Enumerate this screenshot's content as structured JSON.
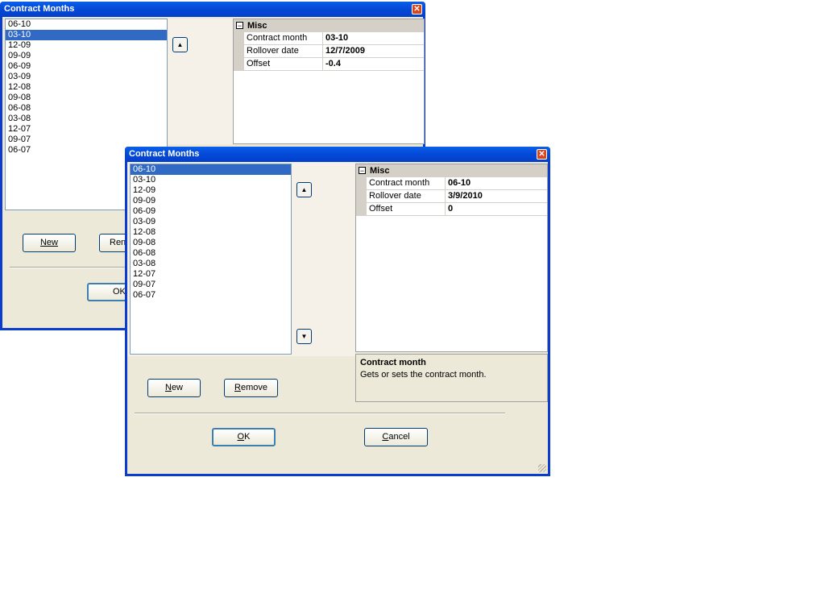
{
  "back_window": {
    "title": "Contract Months",
    "months": [
      "06-10",
      "03-10",
      "12-09",
      "09-09",
      "06-09",
      "03-09",
      "12-08",
      "09-08",
      "06-08",
      "03-08",
      "12-07",
      "09-07",
      "06-07"
    ],
    "selected_index": 1,
    "property_grid": {
      "category": "Misc",
      "rows": [
        {
          "name": "Contract month",
          "value": "03-10"
        },
        {
          "name": "Rollover date",
          "value": "12/7/2009"
        },
        {
          "name": "Offset",
          "value": "-0.4"
        }
      ]
    },
    "buttons": {
      "new": "New",
      "remove_partial": "Ren",
      "ok_partial": "OK"
    }
  },
  "front_window": {
    "title": "Contract Months",
    "months": [
      "06-10",
      "03-10",
      "12-09",
      "09-09",
      "06-09",
      "03-09",
      "12-08",
      "09-08",
      "06-08",
      "03-08",
      "12-07",
      "09-07",
      "06-07"
    ],
    "selected_index": 0,
    "property_grid": {
      "category": "Misc",
      "rows": [
        {
          "name": "Contract month",
          "value": "06-10"
        },
        {
          "name": "Rollover date",
          "value": "3/9/2010"
        },
        {
          "name": "Offset",
          "value": "0"
        }
      ]
    },
    "description": {
      "title": "Contract month",
      "text": "Gets or sets the contract month."
    },
    "buttons": {
      "new": {
        "mnemonic": "N",
        "rest": "ew"
      },
      "remove": {
        "mnemonic": "R",
        "rest": "emove"
      },
      "ok": {
        "mnemonic": "O",
        "rest": "K"
      },
      "cancel": {
        "mnemonic": "C",
        "rest": "ancel"
      }
    }
  },
  "icons": {
    "close": "close-icon",
    "up": "arrow-up-icon",
    "down": "arrow-down-icon",
    "collapse": "collapse-minus-icon"
  },
  "colors": {
    "titlebar": "#0449d8",
    "selection": "#316ac5",
    "dialog_bg": "#ece9d8"
  }
}
